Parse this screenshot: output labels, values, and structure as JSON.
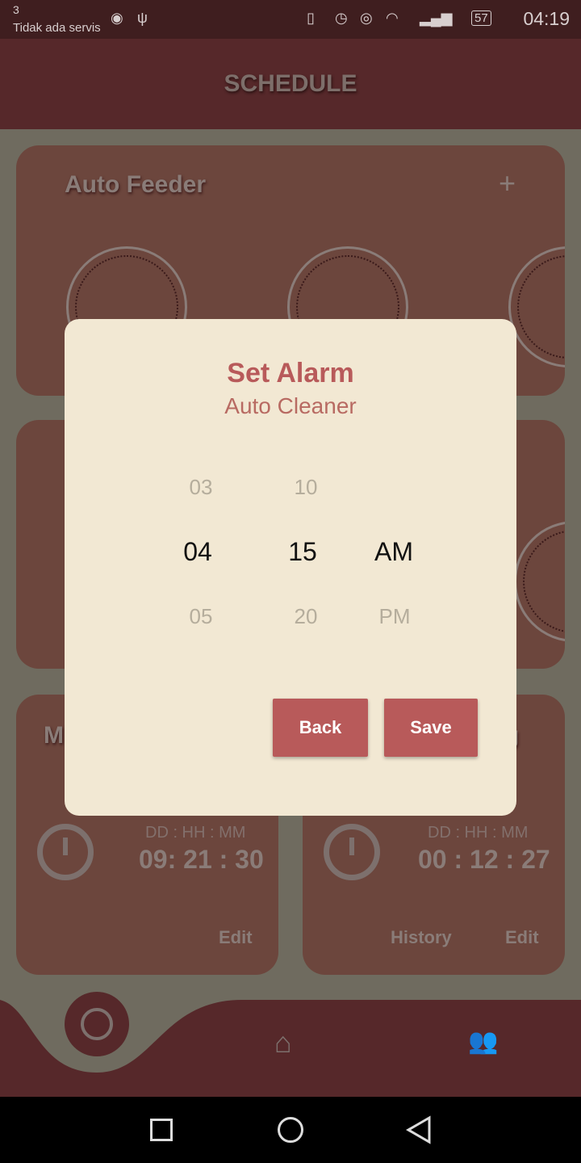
{
  "status_bar": {
    "notif_count": "3",
    "carrier": "Tidak ada servis",
    "battery": "57",
    "time": "04:19"
  },
  "header": {
    "title": "SCHEDULE"
  },
  "cards": {
    "feeder": {
      "title": "Auto Feeder",
      "add": "+"
    },
    "left_bottom": {
      "title_fragment": "M",
      "timer_label": "DD : HH : MM",
      "timer_value": "09: 21 : 30",
      "edit": "Edit"
    },
    "right_bottom": {
      "title_fragment": "g",
      "timer_label": "DD : HH : MM",
      "timer_value": "00 : 12 : 27",
      "history": "History",
      "edit": "Edit"
    }
  },
  "dialog": {
    "title": "Set Alarm",
    "subtitle": "Auto Cleaner",
    "hours": {
      "prev": "03",
      "selected": "04",
      "next": "05"
    },
    "minutes": {
      "prev": "10",
      "selected": "15",
      "next": "20"
    },
    "period": {
      "selected": "AM",
      "next": "PM"
    },
    "back": "Back",
    "save": "Save"
  },
  "colors": {
    "header": "#56282a",
    "card": "#6c463d",
    "dialog": "#f2e8d3",
    "accent": "#b85a5a"
  }
}
